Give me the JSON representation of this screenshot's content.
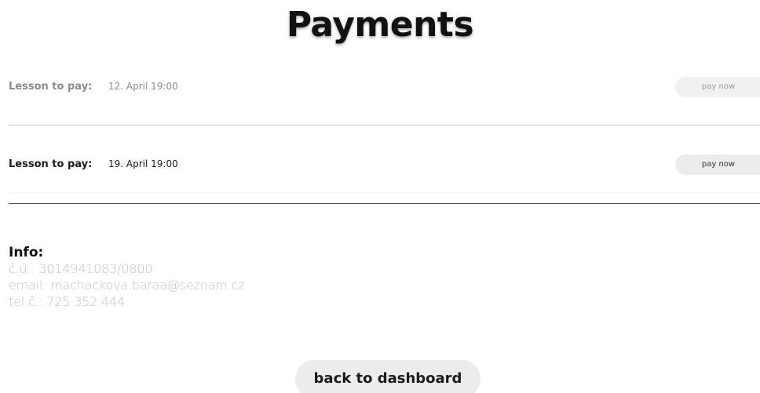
{
  "page": {
    "title": "Payments"
  },
  "lessons": [
    {
      "label": "Lesson to pay:",
      "datetime": "12. April 19:00",
      "button_label": "pay now"
    },
    {
      "label": "Lesson to pay:",
      "datetime": "19. April 19:00",
      "button_label": "pay now"
    }
  ],
  "info": {
    "heading": "Info:",
    "account": "č.ú.: 3014941083/0800",
    "email": "email: machackova.baraa@seznam.cz",
    "phone": "tel.č.: 725 352 444"
  },
  "footer": {
    "back_label": "back to dashboard"
  },
  "colors": {
    "text_dark": "#111111",
    "text_muted": "#8c8c8c",
    "info_text": "#c2c2c2",
    "button_bg": "#ececec"
  }
}
